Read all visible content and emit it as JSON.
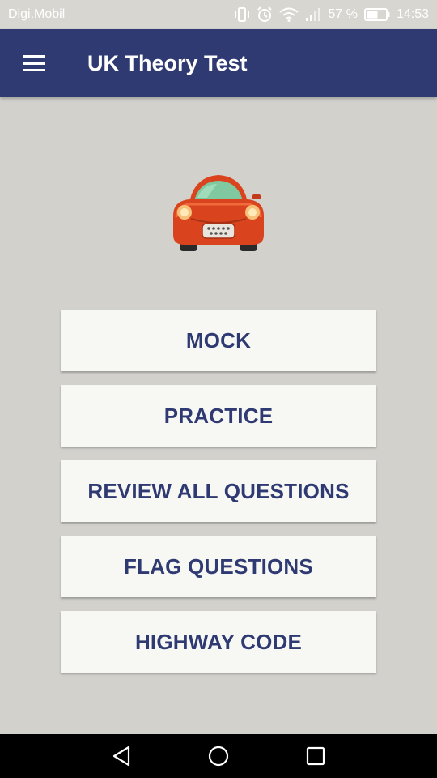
{
  "status_bar": {
    "carrier": "Digi.Mobil",
    "battery_text": "57 %",
    "time": "14:53",
    "icons": [
      "vibrate-icon",
      "alarm-icon",
      "wifi-icon",
      "signal-icon",
      "battery-icon"
    ]
  },
  "app_bar": {
    "title": "UK Theory Test",
    "menu_icon": "hamburger-menu-icon"
  },
  "logo": {
    "icon": "car-icon",
    "colors": {
      "body": "#d9441e",
      "windshield": "#7fc8a0",
      "wheels": "#2a2a2a"
    }
  },
  "menu": {
    "items": [
      {
        "label": "MOCK"
      },
      {
        "label": "PRACTICE"
      },
      {
        "label": "REVIEW ALL QUESTIONS"
      },
      {
        "label": "FLAG QUESTIONS"
      },
      {
        "label": "HIGHWAY CODE"
      }
    ]
  },
  "nav_bar": {
    "icons": [
      "back-icon",
      "home-icon",
      "recents-icon"
    ]
  },
  "colors": {
    "primary": "#2f3a73",
    "background": "#d2d1cc",
    "button_bg": "#f7f7f3",
    "button_text": "#2f3a73"
  }
}
